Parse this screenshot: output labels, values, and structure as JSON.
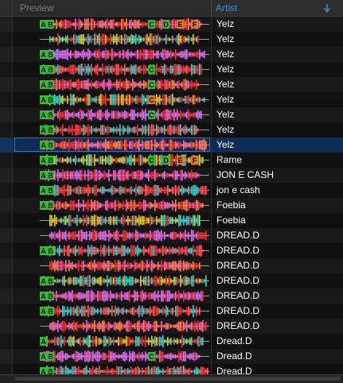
{
  "header": {
    "preview_label": "Preview",
    "artist_label": "Artist",
    "sort_icon": "sort-descending-arrow-icon",
    "artist_color": "#3d8fe0"
  },
  "rows": [
    {
      "artist": "Yelz",
      "cues": [
        "A",
        "B",
        "C",
        "D",
        "E",
        "F"
      ],
      "selected": false
    },
    {
      "artist": "Yelz",
      "cues": [],
      "selected": false
    },
    {
      "artist": "Yelz",
      "cues": [
        "A",
        "B"
      ],
      "selected": false
    },
    {
      "artist": "Yelz",
      "cues": [
        "A",
        "B",
        "C"
      ],
      "selected": false
    },
    {
      "artist": "Yelz",
      "cues": [
        "A",
        "B",
        "C"
      ],
      "selected": false
    },
    {
      "artist": "Yelz",
      "cues": [
        "A",
        "B",
        "C"
      ],
      "selected": false
    },
    {
      "artist": "Yelz",
      "cues": [
        "A",
        "B",
        "C"
      ],
      "selected": false
    },
    {
      "artist": "Yelz",
      "cues": [
        "A",
        "B"
      ],
      "selected": false
    },
    {
      "artist": "Yelz",
      "cues": [
        "A",
        "B"
      ],
      "selected": true
    },
    {
      "artist": "Rame",
      "cues": [
        "A",
        "B",
        "C",
        "D",
        "E",
        "F"
      ],
      "selected": false
    },
    {
      "artist": "JON E CASH",
      "cues": [
        "A",
        "B"
      ],
      "selected": false
    },
    {
      "artist": "jon e cash",
      "cues": [
        "A",
        "B"
      ],
      "selected": false
    },
    {
      "artist": "Foebia",
      "cues": [
        "A",
        "B"
      ],
      "selected": false
    },
    {
      "artist": "Foebia",
      "cues": [],
      "selected": false
    },
    {
      "artist": "DREAD.D",
      "cues": [],
      "selected": false
    },
    {
      "artist": "DREAD.D",
      "cues": [
        "A",
        "B"
      ],
      "selected": false
    },
    {
      "artist": "DREAD.D",
      "cues": [],
      "selected": false
    },
    {
      "artist": "DREAD.D",
      "cues": [
        "A",
        "B"
      ],
      "selected": false
    },
    {
      "artist": "DREAD.D",
      "cues": [
        "A",
        "B"
      ],
      "selected": false
    },
    {
      "artist": "DREAD.D",
      "cues": [
        "A",
        "B"
      ],
      "selected": false
    },
    {
      "artist": "DREAD.D",
      "cues": [],
      "selected": false
    },
    {
      "artist": "Dread.D",
      "cues": [
        "A"
      ],
      "selected": false
    },
    {
      "artist": "Dread.D",
      "cues": [
        "A",
        "B",
        "C"
      ],
      "selected": false
    },
    {
      "artist": "Dread.D",
      "cues": [
        "A",
        "B"
      ],
      "selected": false
    }
  ],
  "colors": {
    "cue_green": "#2fbf2f",
    "cue_orange": "#e07a20",
    "wave_red": "#e03a3a",
    "wave_pink": "#e870c8",
    "wave_cyan": "#40d0d0",
    "wave_yellow": "#e0d040",
    "selection": "#0c2c56"
  }
}
